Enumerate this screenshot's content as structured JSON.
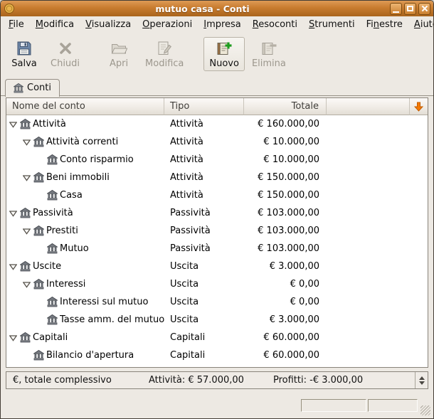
{
  "window": {
    "title": "mutuo casa - Conti",
    "controls": [
      "minimize-icon",
      "maximize-icon",
      "close-icon"
    ],
    "app_icon": "gnucash-coin-icon"
  },
  "colors": {
    "titlebar": "#C87C2F",
    "background": "#EDE9E3",
    "header_arrow_orange": "#F57900"
  },
  "menubar": {
    "items": [
      {
        "pre": "",
        "key": "F",
        "post": "ile"
      },
      {
        "pre": "",
        "key": "M",
        "post": "odifica"
      },
      {
        "pre": "",
        "key": "V",
        "post": "isualizza"
      },
      {
        "pre": "",
        "key": "O",
        "post": "perazioni"
      },
      {
        "pre": "",
        "key": "I",
        "post": "mpresa"
      },
      {
        "pre": "",
        "key": "R",
        "post": "esoconti"
      },
      {
        "pre": "",
        "key": "S",
        "post": "trumenti"
      },
      {
        "pre": "Fi",
        "key": "n",
        "post": "estre"
      },
      {
        "pre": "",
        "key": "A",
        "post": "iuto"
      }
    ]
  },
  "toolbar": {
    "buttons": [
      {
        "label": "Salva",
        "enabled": true,
        "icon": "save-icon"
      },
      {
        "label": "Chiudi",
        "enabled": false,
        "icon": "close-tab-icon"
      },
      {
        "label": "Apri",
        "enabled": false,
        "icon": "open-account-icon"
      },
      {
        "label": "Modifica",
        "enabled": false,
        "icon": "edit-account-icon"
      },
      {
        "label": "Nuovo",
        "enabled": true,
        "icon": "new-account-icon"
      },
      {
        "label": "Elimina",
        "enabled": false,
        "icon": "delete-account-icon"
      }
    ]
  },
  "tabs": [
    {
      "label": "Conti",
      "active": true,
      "icon": "accounts-icon"
    }
  ],
  "table": {
    "headers": {
      "name": "Nome del conto",
      "type": "Tipo",
      "total": "Totale"
    },
    "column_button_icon": "orange-down-arrow-icon",
    "rows": [
      {
        "name": "Attività",
        "type": "Attività",
        "total": "€ 160.000,00",
        "level": 0,
        "expander": true
      },
      {
        "name": "Attività correnti",
        "type": "Attività",
        "total": "€ 10.000,00",
        "level": 1,
        "expander": true
      },
      {
        "name": "Conto risparmio",
        "type": "Attività",
        "total": "€ 10.000,00",
        "level": 2,
        "expander": false
      },
      {
        "name": "Beni immobili",
        "type": "Attività",
        "total": "€ 150.000,00",
        "level": 1,
        "expander": true
      },
      {
        "name": "Casa",
        "type": "Attività",
        "total": "€ 150.000,00",
        "level": 2,
        "expander": false
      },
      {
        "name": "Passività",
        "type": "Passività",
        "total": "€ 103.000,00",
        "level": 0,
        "expander": true
      },
      {
        "name": "Prestiti",
        "type": "Passività",
        "total": "€ 103.000,00",
        "level": 1,
        "expander": true
      },
      {
        "name": "Mutuo",
        "type": "Passività",
        "total": "€ 103.000,00",
        "level": 2,
        "expander": false
      },
      {
        "name": "Uscite",
        "type": "Uscita",
        "total": "€ 3.000,00",
        "level": 0,
        "expander": true
      },
      {
        "name": "Interessi",
        "type": "Uscita",
        "total": "€ 0,00",
        "level": 1,
        "expander": true
      },
      {
        "name": "Interessi sul mutuo",
        "type": "Uscita",
        "total": "€ 0,00",
        "level": 2,
        "expander": false
      },
      {
        "name": "Tasse amm. del mutuo",
        "type": "Uscita",
        "total": "€ 3.000,00",
        "level": 2,
        "expander": false
      },
      {
        "name": "Capitali",
        "type": "Capitali",
        "total": "€ 60.000,00",
        "level": 0,
        "expander": true
      },
      {
        "name": "Bilancio d'apertura",
        "type": "Capitali",
        "total": "€ 60.000,00",
        "level": 1,
        "expander": false
      }
    ]
  },
  "summary_bar": {
    "scope": "€, totale complessivo",
    "assets": "Attività: € 57.000,00",
    "profits": "Profitti: -€ 3.000,00"
  }
}
